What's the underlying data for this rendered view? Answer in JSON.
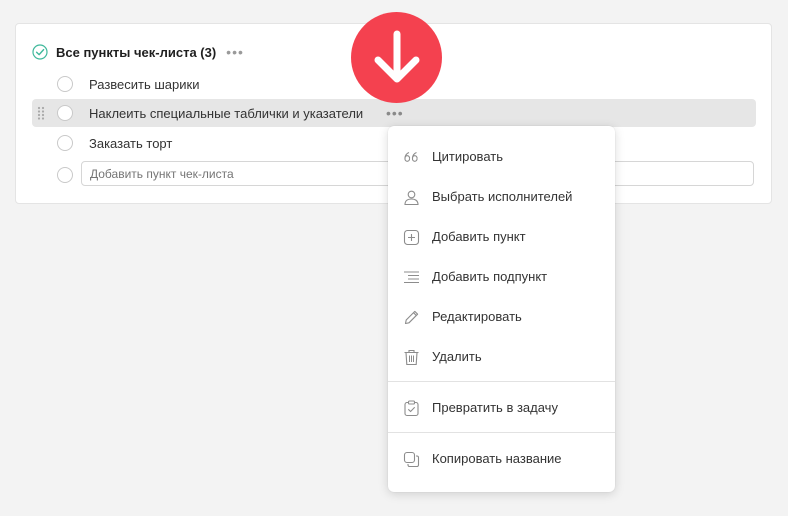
{
  "checklist": {
    "title": "Все пункты чек-листа (3)",
    "more_glyph": "•••",
    "items": [
      {
        "label": "Развесить шарики"
      },
      {
        "label": "Наклеить специальные таблички и указатели"
      },
      {
        "label": "Заказать торт"
      }
    ],
    "add_placeholder": "Добавить пункт чек-листа"
  },
  "context_menu": {
    "items": [
      {
        "label": "Цитировать",
        "icon": "quote-icon"
      },
      {
        "label": "Выбрать исполнителей",
        "icon": "user-icon"
      },
      {
        "label": "Добавить пункт",
        "icon": "add-square-icon"
      },
      {
        "label": "Добавить подпункт",
        "icon": "indent-list-icon"
      },
      {
        "label": "Редактировать",
        "icon": "pencil-icon"
      },
      {
        "label": "Удалить",
        "icon": "trash-icon"
      },
      {
        "label": "Превратить в задачу",
        "icon": "clipboard-check-icon"
      },
      {
        "label": "Копировать название",
        "icon": "copy-icon"
      }
    ]
  },
  "colors": {
    "accent_check": "#3fb89b",
    "arrow_badge": "#f4414f"
  }
}
